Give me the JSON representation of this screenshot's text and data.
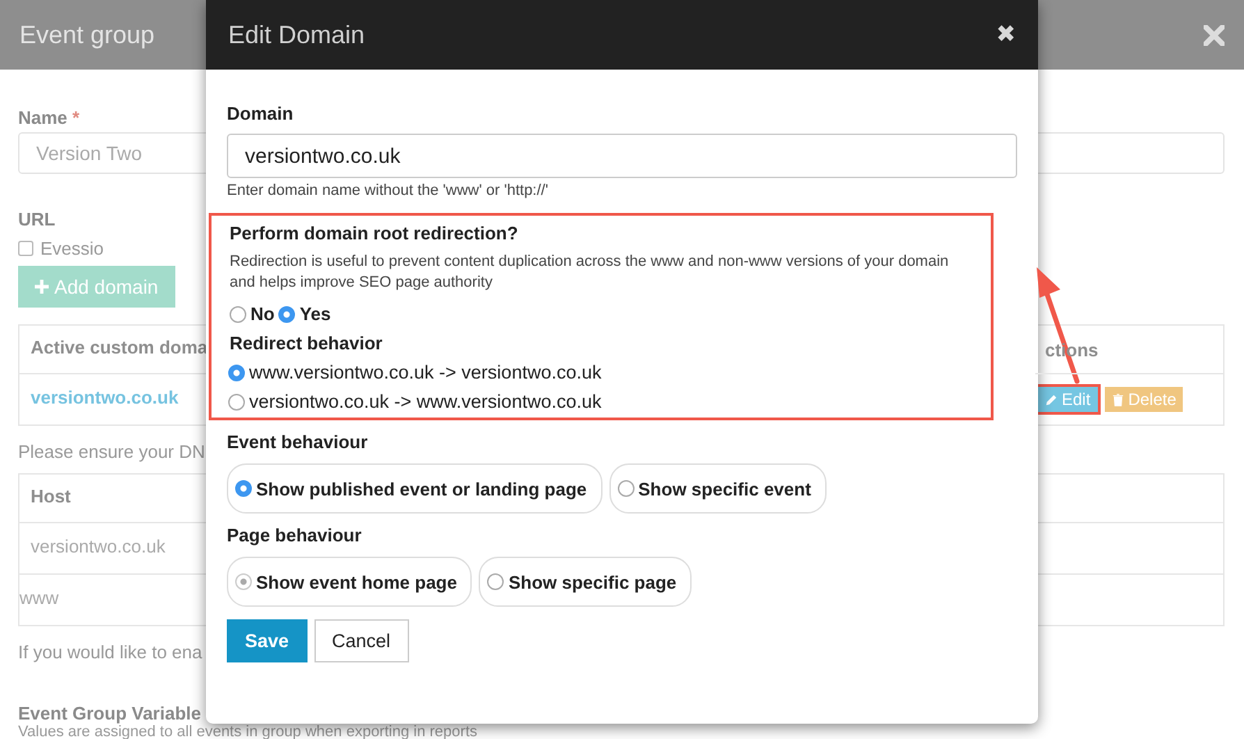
{
  "background": {
    "title": "Event group",
    "name_label": "Name",
    "required_mark": "*",
    "name_value": "Version Two",
    "url_label": "URL",
    "checkbox": {
      "label": "Evessio",
      "checked": false
    },
    "add_button": "Add domain",
    "domains_table": {
      "columns": [
        "Active custom doma",
        "ctions"
      ],
      "rows": [
        {
          "domain": "versiontwo.co.uk",
          "actions": [
            {
              "kind": "edit",
              "label": "Edit",
              "highlighted": true
            },
            {
              "kind": "delete",
              "label": "Delete",
              "highlighted": false
            }
          ]
        }
      ]
    },
    "dns_note": "Please ensure your DN",
    "hosts_table": {
      "columns": [
        "Host"
      ],
      "rows": [
        "versiontwo.co.uk",
        "www"
      ]
    },
    "enable_note": "If you would like to ena",
    "variables_heading": "Event Group Variable",
    "variables_note": "Values are assigned to all events in group when exporting in reports"
  },
  "modal": {
    "title": "Edit Domain",
    "close": "✖",
    "domain": {
      "label": "Domain",
      "value": "versiontwo.co.uk",
      "help": "Enter domain name without the 'www' or 'http://'"
    },
    "redirection": {
      "highlighted": true,
      "title": "Perform domain root redirection?",
      "description": "Redirection is useful to prevent content duplication across the www and non-www versions of your domain and helps improve SEO page authority",
      "choices": [
        {
          "label": "No",
          "selected": false
        },
        {
          "label": "Yes",
          "selected": true
        }
      ],
      "behavior_label": "Redirect behavior",
      "behaviors": [
        {
          "label": "www.versiontwo.co.uk -> versiontwo.co.uk",
          "selected": true
        },
        {
          "label": "versiontwo.co.uk -> www.versiontwo.co.uk",
          "selected": false
        }
      ]
    },
    "groups": [
      {
        "label": "Event behaviour",
        "muted": false,
        "options": [
          {
            "label": "Show published event or landing page",
            "selected": true
          },
          {
            "label": "Show specific event",
            "selected": false
          }
        ]
      },
      {
        "label": "Page behaviour",
        "muted": true,
        "options": [
          {
            "label": "Show event home page",
            "selected": true
          },
          {
            "label": "Show specific page",
            "selected": false
          }
        ]
      }
    ],
    "buttons": [
      {
        "kind": "primary",
        "label": "Save"
      },
      {
        "kind": "default",
        "label": "Cancel"
      }
    ]
  }
}
